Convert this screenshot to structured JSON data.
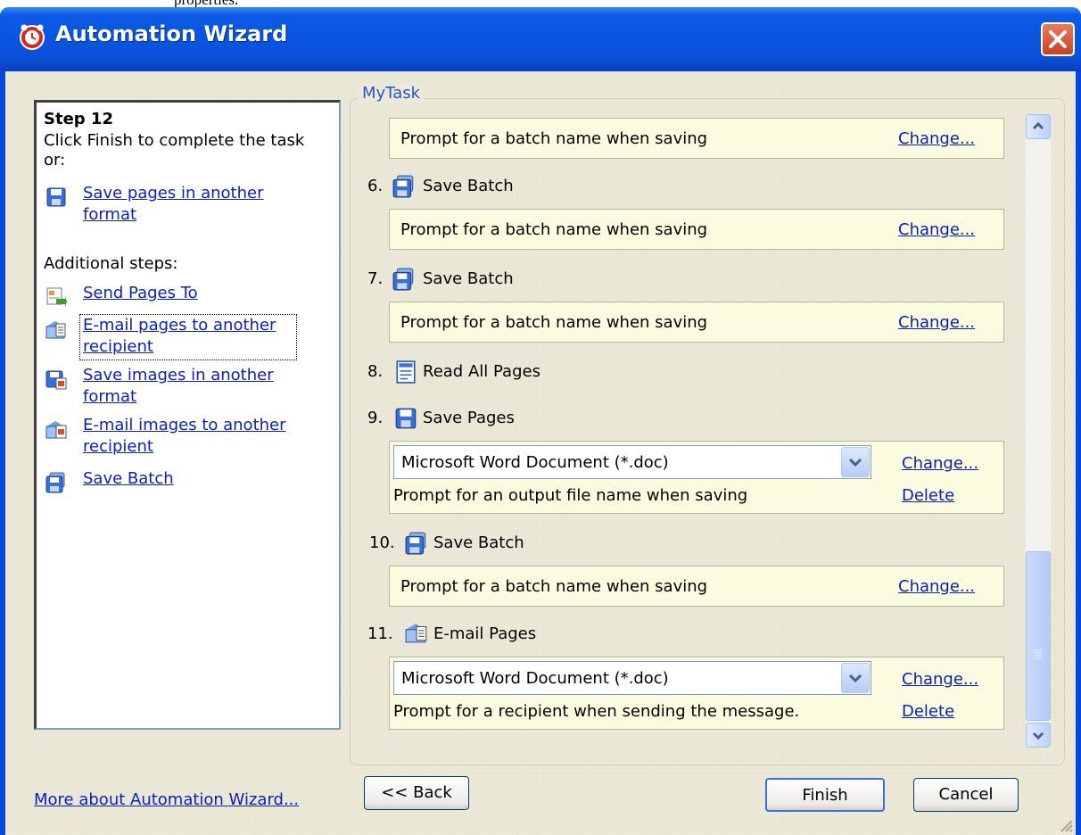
{
  "top_caption": "properties.",
  "window": {
    "title": "Automation Wizard"
  },
  "left_panel": {
    "step_title": "Step 12",
    "instruction_line1": "Click Finish to complete the task",
    "instruction_line2": "or:",
    "save_pages_line1": "Save pages in another",
    "save_pages_line2": "format",
    "additional_label": "Additional steps:",
    "send_pages": "Send Pages To",
    "email_pages_line1": "E-mail pages to another",
    "email_pages_line2": "recipient",
    "save_images_line1": "Save images in another",
    "save_images_line2": "format",
    "email_images_line1": "E-mail images to another",
    "email_images_line2": "recipient",
    "save_batch": "Save Batch"
  },
  "task": {
    "group_label": "MyTask",
    "top_box_text": "Prompt for a batch name when saving",
    "change_label": "Change...",
    "delete_label": "Delete",
    "steps": [
      {
        "num": "6.",
        "title": "Save Batch",
        "text": "Prompt for a batch name when saving"
      },
      {
        "num": "7.",
        "title": "Save Batch",
        "text": "Prompt for a batch name when saving"
      },
      {
        "num": "8.",
        "title": "Read All Pages"
      },
      {
        "num": "9.",
        "title": "Save Pages",
        "format": "Microsoft Word Document (*.doc)",
        "text": "Prompt for an output file name when saving"
      },
      {
        "num": "10.",
        "title": "Save Batch",
        "text": "Prompt for a batch name when saving"
      },
      {
        "num": "11.",
        "title": "E-mail Pages",
        "format": "Microsoft Word Document (*.doc)",
        "text": "Prompt for a recipient when sending the message."
      }
    ]
  },
  "footer": {
    "more_link": "More about Automation Wizard...",
    "back_label": "<< Back",
    "finish_label": "Finish",
    "cancel_label": "Cancel"
  },
  "colors": {
    "titlebar": "#0a55de",
    "link": "#0b21b8",
    "panel_bg": "#ece9d8",
    "step_box": "#fbfbe0"
  }
}
